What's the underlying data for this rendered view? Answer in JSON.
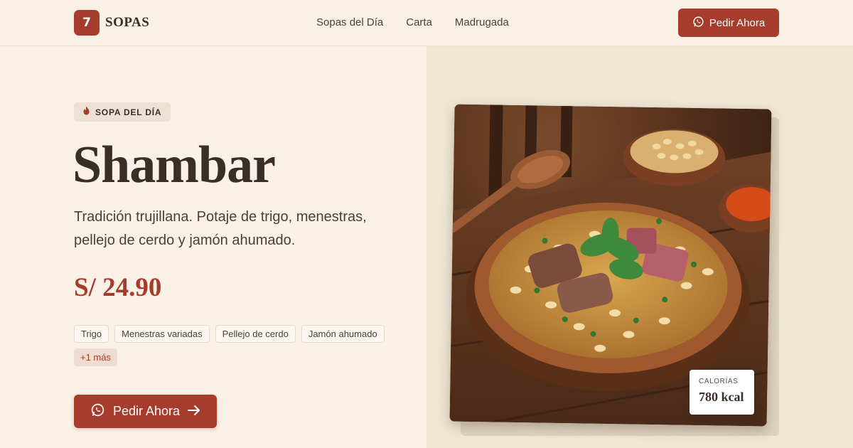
{
  "brand": {
    "badge_number": "7",
    "name": "SOPAS",
    "color": "#a63c2c"
  },
  "nav": {
    "items": [
      "Sopas del Día",
      "Carta",
      "Madrugada"
    ]
  },
  "header": {
    "order_label": "Pedir Ahora",
    "order_icon": "whatsapp-icon"
  },
  "hero": {
    "badge_icon": "flame-icon",
    "badge": "SOPA DEL DÍA",
    "title": "Shambar",
    "description": "Tradición trujillana. Potaje de trigo, menestras, pellejo de cerdo y jamón ahumado.",
    "price": "S/ 24.90",
    "tags": [
      "Trigo",
      "Menestras variadas",
      "Pellejo de cerdo",
      "Jamón ahumado"
    ],
    "more": "+1 más",
    "cta_label": "Pedir Ahora",
    "cta_icons": [
      "whatsapp-icon",
      "arrow-right-icon"
    ]
  },
  "image": {
    "subject": "shambar-soup-bowl",
    "calories_label": "CALORÍAS",
    "calories_value": "780 kcal"
  }
}
